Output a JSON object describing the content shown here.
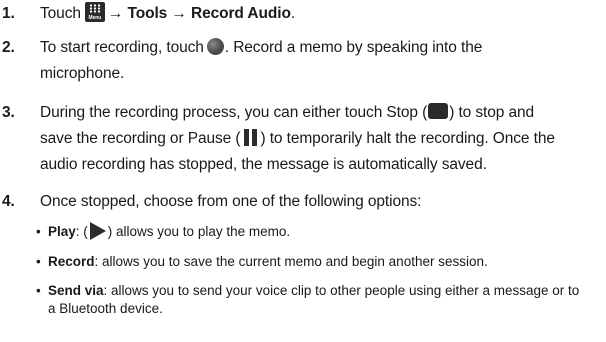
{
  "steps": [
    {
      "num": "1.",
      "pre": "Touch",
      "menu_label": "Menu",
      "arrow1": "→ ",
      "b1": "Tools",
      "arrow2": " → ",
      "b2": "Record Audio",
      "end": "."
    },
    {
      "num": "2.",
      "line1_pre": "To start recording, touch",
      "line1_post": ". Record a memo by speaking into the",
      "line2": "microphone."
    },
    {
      "num": "3.",
      "line1_pre": "During the recording process, you can either touch Stop (",
      "line1_post": ") to stop and",
      "line2_pre": "save the recording or Pause (",
      "line2_post": ") to temporarily halt the recording. Once the",
      "line3": "audio recording has stopped, the message is automatically saved."
    },
    {
      "num": "4.",
      "text": "Once stopped, choose from one of the following options:"
    }
  ],
  "options": [
    {
      "dot": "•",
      "term": "Play",
      "pre": ": (",
      "post": ") allows you to play the memo."
    },
    {
      "dot": "•",
      "term": "Record",
      "text": ": allows you to save the current memo and begin another session."
    },
    {
      "dot": "•",
      "term": "Send via",
      "line1": ": allows you to send your voice clip to other people using either a message or to",
      "line2": "a Bluetooth device."
    }
  ]
}
